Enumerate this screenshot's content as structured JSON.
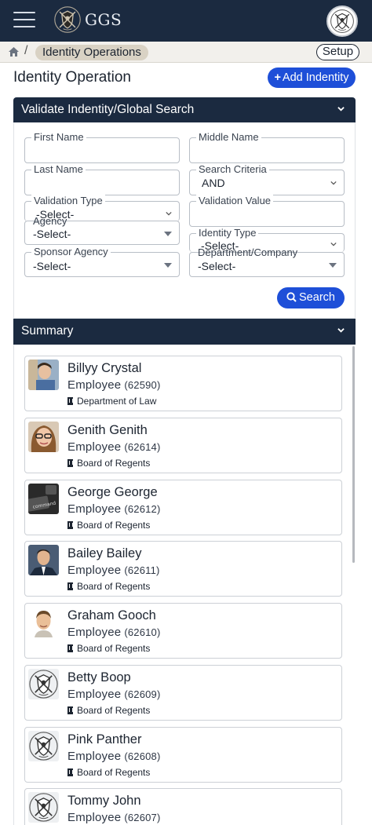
{
  "app": {
    "logo_text": "GGS",
    "logo_icon": "shield-crest-icon",
    "avatar_icon": "shield-crest-icon"
  },
  "nav": {
    "menu_icon": "hamburger-icon",
    "home_icon": "home-icon"
  },
  "breadcrumb": {
    "separator": "/",
    "current": "Identity Operations",
    "setup_label": "Setup"
  },
  "page": {
    "title": "Identity Operation",
    "add_button_icon": "+",
    "add_button_label": "Add Indentity"
  },
  "search_panel": {
    "title": "Validate Indentity/Global Search",
    "fields": {
      "first_name": {
        "label": "First Name",
        "value": ""
      },
      "middle_name": {
        "label": "Middle Name",
        "value": ""
      },
      "last_name": {
        "label": "Last Name",
        "value": ""
      },
      "search_criteria": {
        "label": "Search Criteria",
        "value": "AND"
      },
      "validation_type": {
        "label": "Validation Type",
        "value": "-Select-"
      },
      "validation_value": {
        "label": "Validation Value",
        "value": ""
      },
      "agency": {
        "label": "Agency",
        "value": "-Select-"
      },
      "identity_type": {
        "label": "Identity Type",
        "value": "-Select-"
      },
      "sponsor_agency": {
        "label": "Sponsor Agency",
        "value": "-Select-"
      },
      "department_company": {
        "label": "Department/Company",
        "value": "-Select-"
      }
    },
    "search_label": "Search"
  },
  "summary_panel": {
    "title": "Summary",
    "cards": [
      {
        "name": "Billyy Crystal",
        "role": "Employee",
        "id": "(62590)",
        "department": "Department of Law",
        "photo": "child-photo"
      },
      {
        "name": "Genith Genith",
        "role": "Employee",
        "id": "(62614)",
        "department": "Board of Regents",
        "photo": "woman-glasses-photo"
      },
      {
        "name": "George George",
        "role": "Employee",
        "id": "(62612)",
        "department": "Board of Regents",
        "photo": "keyboard-photo"
      },
      {
        "name": "Bailey Bailey",
        "role": "Employee",
        "id": "(62611)",
        "department": "Board of Regents",
        "photo": "man-suit-photo"
      },
      {
        "name": "Graham Gooch",
        "role": "Employee",
        "id": "(62610)",
        "department": "Board of Regents",
        "photo": "man-portrait-photo"
      },
      {
        "name": "Betty Boop",
        "role": "Employee",
        "id": "(62609)",
        "department": "Board of Regents",
        "photo": "shield-crest-icon"
      },
      {
        "name": "Pink Panther",
        "role": "Employee",
        "id": "(62608)",
        "department": "Board of Regents",
        "photo": "shield-crest-icon"
      },
      {
        "name": "Tommy John",
        "role": "Employee",
        "id": "(62607)",
        "department": "",
        "photo": "shield-crest-icon"
      }
    ]
  },
  "colors": {
    "navy": "#1b2a40",
    "accent_blue": "#1e4fd8",
    "crumb_bg": "#f2f0ec",
    "crumb_pill": "#d9d2c4"
  }
}
